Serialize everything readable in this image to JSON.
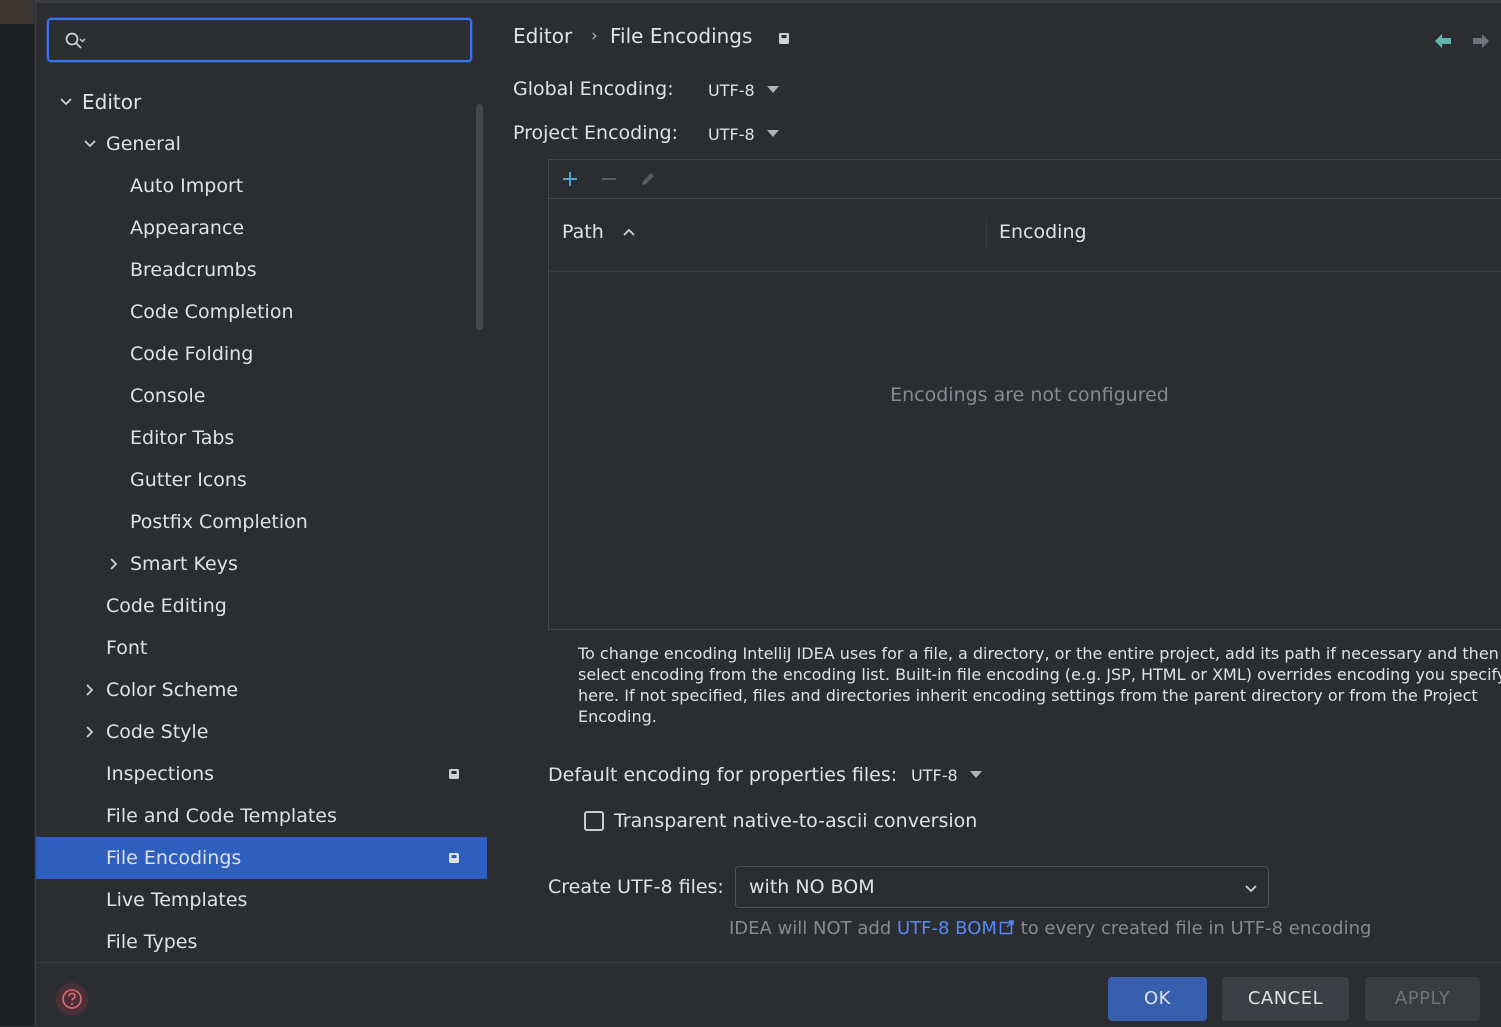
{
  "search": {
    "placeholder": ""
  },
  "breadcrumb": {
    "parent": "Editor",
    "separator": "›",
    "current": "File Encodings"
  },
  "tree": {
    "editor": "Editor",
    "general": "General",
    "auto_import": "Auto Import",
    "appearance": "Appearance",
    "breadcrumbs": "Breadcrumbs",
    "code_completion": "Code Completion",
    "code_folding": "Code Folding",
    "console": "Console",
    "editor_tabs": "Editor Tabs",
    "gutter_icons": "Gutter Icons",
    "postfix_completion": "Postfix Completion",
    "smart_keys": "Smart Keys",
    "code_editing": "Code Editing",
    "font": "Font",
    "color_scheme": "Color Scheme",
    "code_style": "Code Style",
    "inspections": "Inspections",
    "file_code_templates": "File and Code Templates",
    "file_encodings": "File Encodings",
    "live_templates": "Live Templates",
    "file_types": "File Types"
  },
  "settings": {
    "global_label": "Global Encoding:",
    "global_value": "UTF-8",
    "project_label": "Project Encoding:",
    "project_value": "UTF-8",
    "table_header_path": "Path",
    "table_header_encoding": "Encoding",
    "empty_text": "Encodings are not configured",
    "description": "To change encoding IntelliJ IDEA uses for a file, a directory, or the entire project, add its path if necessary and then select encoding from the encoding list. Built-in file encoding (e.g. JSP, HTML or XML) overrides encoding you specify here. If not specified, files and directories inherit encoding settings from the parent directory or from the Project Encoding.",
    "props_label": "Default encoding for properties files:",
    "props_value": "UTF-8",
    "transparent_label": "Transparent native-to-ascii conversion",
    "transparent_checked": false,
    "create_label": "Create UTF-8 files:",
    "create_value": "with NO BOM",
    "hint_before": "IDEA will NOT add ",
    "hint_link": "UTF-8 BOM",
    "hint_after": " to every created file in UTF-8 encoding"
  },
  "footer": {
    "ok": "OK",
    "cancel": "CANCEL",
    "apply": "APPLY"
  },
  "colors": {
    "accent": "#3574f0",
    "selection": "#2e5fbf",
    "link": "#548af7",
    "nav_back": "#5fb8b0"
  }
}
